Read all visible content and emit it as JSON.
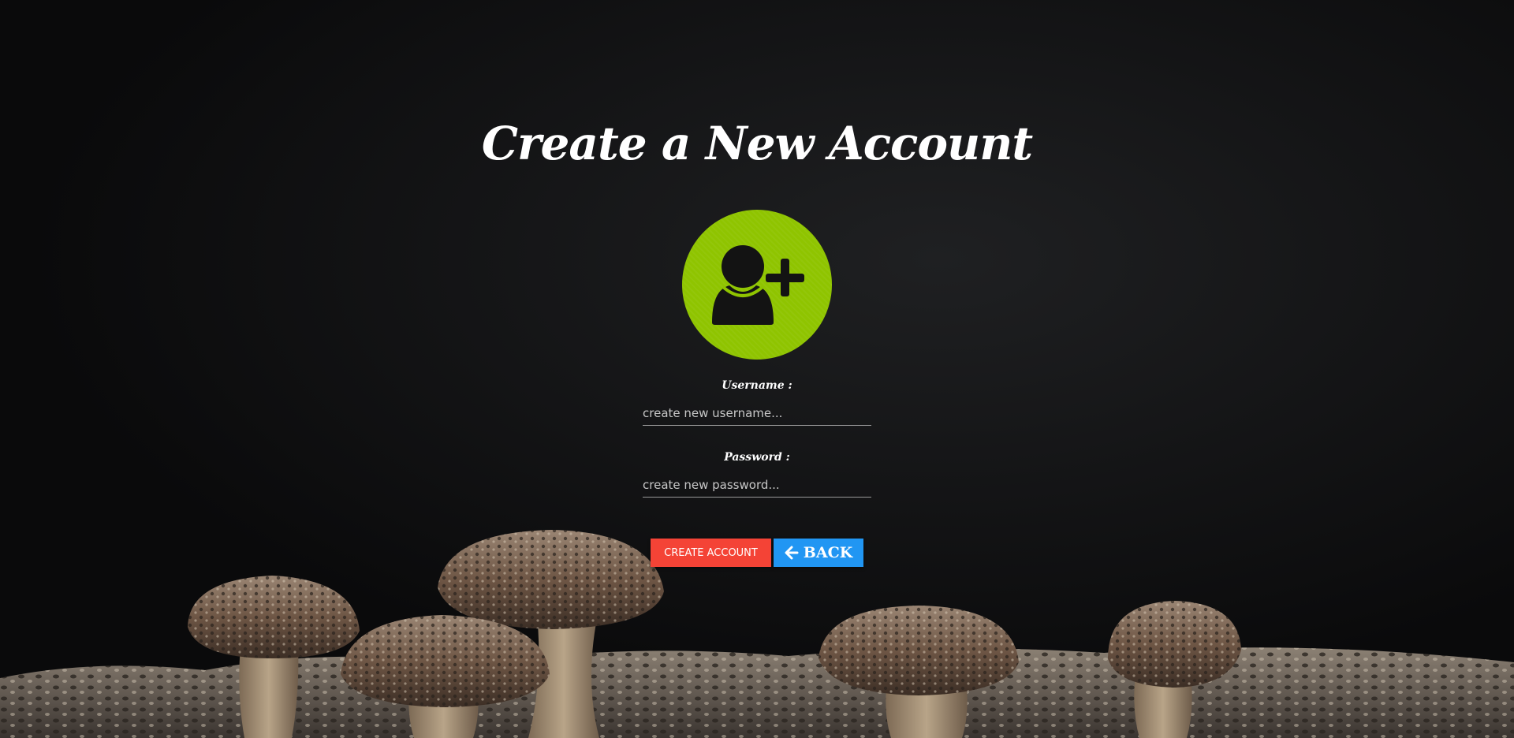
{
  "page": {
    "title": "Create a New Account"
  },
  "avatar": {
    "icon": "add-user-icon",
    "color": "#8fc400"
  },
  "form": {
    "username": {
      "label": "Username :",
      "placeholder": "create new username...",
      "value": ""
    },
    "password": {
      "label": "Password :",
      "placeholder": "create new password...",
      "value": ""
    }
  },
  "actions": {
    "create_label": "CREATE ACCOUNT",
    "create_color": "#f44336",
    "back_label": "BACK",
    "back_icon": "arrow-left-icon",
    "back_color": "#2196f3"
  },
  "background": {
    "image": "mushrooms-photo"
  }
}
